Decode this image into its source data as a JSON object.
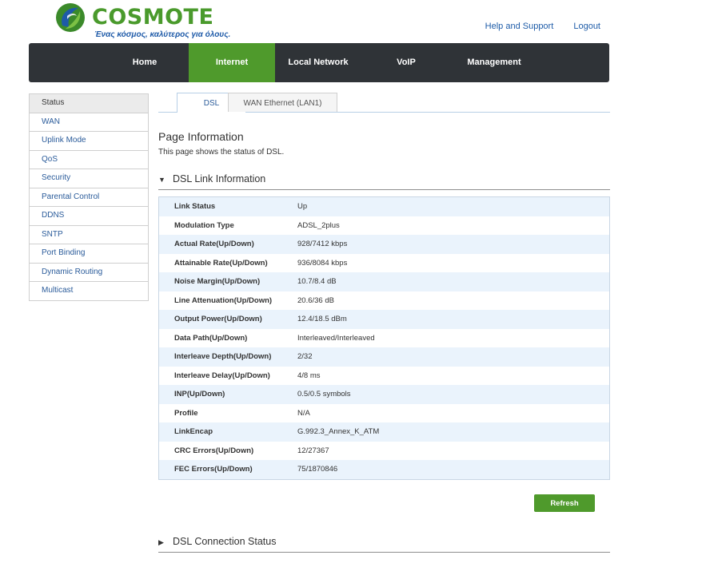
{
  "header": {
    "brand": "COSMOTE",
    "tagline": "Ένας κόσμος, καλύτερος για όλους.",
    "links": [
      "Help and Support",
      "Logout"
    ]
  },
  "nav": {
    "items": [
      "Home",
      "Internet",
      "Local Network",
      "VoIP",
      "Management"
    ],
    "active": "Internet"
  },
  "sidebar": {
    "items": [
      "Status",
      "WAN",
      "Uplink Mode",
      "QoS",
      "Security",
      "Parental Control",
      "DDNS",
      "SNTP",
      "Port Binding",
      "Dynamic Routing",
      "Multicast"
    ],
    "active": "Status"
  },
  "tabs": [
    "DSL",
    "WAN Ethernet (LAN1)"
  ],
  "page": {
    "title": "Page Information",
    "description": "This page shows the status of DSL."
  },
  "dsl_link": {
    "title": "DSL Link Information",
    "rows": [
      {
        "label": "Link Status",
        "value": "Up"
      },
      {
        "label": "Modulation Type",
        "value": "ADSL_2plus"
      },
      {
        "label": "Actual Rate(Up/Down)",
        "value": "928/7412 kbps"
      },
      {
        "label": "Attainable Rate(Up/Down)",
        "value": "936/8084 kbps"
      },
      {
        "label": "Noise Margin(Up/Down)",
        "value": "10.7/8.4 dB"
      },
      {
        "label": "Line Attenuation(Up/Down)",
        "value": "20.6/36 dB"
      },
      {
        "label": "Output Power(Up/Down)",
        "value": "12.4/18.5 dBm"
      },
      {
        "label": "Data Path(Up/Down)",
        "value": "Interleaved/Interleaved"
      },
      {
        "label": "Interleave Depth(Up/Down)",
        "value": "2/32"
      },
      {
        "label": "Interleave Delay(Up/Down)",
        "value": "4/8 ms"
      },
      {
        "label": "INP(Up/Down)",
        "value": "0.5/0.5 symbols"
      },
      {
        "label": "Profile",
        "value": "N/A"
      },
      {
        "label": "LinkEncap",
        "value": "G.992.3_Annex_K_ATM"
      },
      {
        "label": "CRC Errors(Up/Down)",
        "value": "12/27367"
      },
      {
        "label": "FEC Errors(Up/Down)",
        "value": "75/1870846"
      }
    ]
  },
  "refresh_label": "Refresh",
  "dsl_connection": {
    "title": "DSL Connection Status"
  },
  "icons": {
    "expanded": "triangle-down-icon",
    "collapsed": "triangle-right-icon",
    "logo": "cosmote-logo-icon"
  },
  "colors": {
    "brand_green": "#4f9a2c",
    "brand_blue": "#1e5aa8",
    "nav_bg": "#2f3337",
    "row_alt": "#eaf3fc"
  }
}
